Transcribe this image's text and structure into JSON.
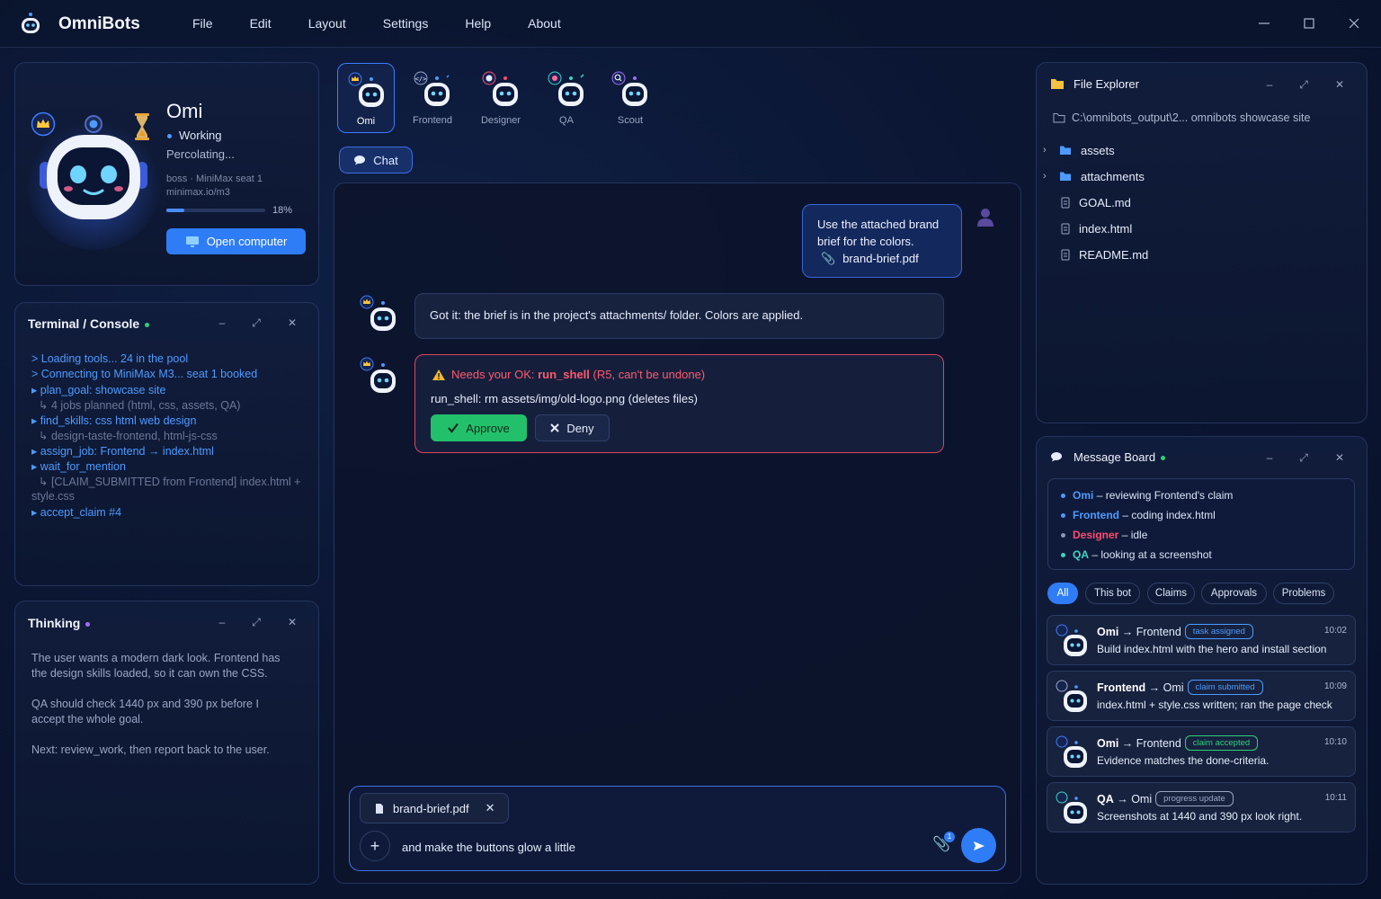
{
  "app": {
    "name": "OmniBots",
    "menu": [
      "File",
      "Edit",
      "Layout",
      "Settings",
      "Help",
      "About"
    ]
  },
  "profile": {
    "name": "Omi",
    "status": "Working",
    "substatus": "Percolating...",
    "meta_line1": "boss · MiniMax seat 1",
    "meta_line2": "minimax.io/m3",
    "progress": 0.18,
    "progress_label": "18%",
    "open_computer_label": "Open computer"
  },
  "terminal": {
    "title": "Terminal / Console",
    "lines": [
      {
        "text": "> Loading tools... 24 in the pool",
        "kind": "main"
      },
      {
        "text": "> Connecting to MiniMax M3... seat 1 booked",
        "kind": "main"
      },
      {
        "text": "▸ plan_goal: showcase site",
        "kind": "main"
      },
      {
        "text": "↳ 4 jobs planned (html, css, assets, QA)",
        "kind": "sub"
      },
      {
        "text": "▸ find_skills: css html web design",
        "kind": "main"
      },
      {
        "text": "↳ design-taste-frontend, html-js-css",
        "kind": "sub"
      },
      {
        "text": "▸ assign_job: Frontend → index.html",
        "kind": "main"
      },
      {
        "text": "▸ wait_for_mention",
        "kind": "main"
      },
      {
        "text": "↳ [CLAIM_SUBMITTED from Frontend] index.html +",
        "kind": "sub"
      },
      {
        "text": "style.css",
        "kind": "sub"
      },
      {
        "text": "▸ accept_claim #4",
        "kind": "main"
      }
    ]
  },
  "thinking": {
    "title": "Thinking",
    "paragraphs": [
      [
        "The user wants a modern dark look. Frontend has",
        "the design skills loaded, so it can own the CSS."
      ],
      [
        "QA should check 1440 px and 390 px before I",
        "accept the whole goal."
      ],
      [
        "Next: review_work, then report back to the user."
      ]
    ]
  },
  "bot_tabs": [
    {
      "label": "Omi",
      "active": true
    },
    {
      "label": "Frontend",
      "active": false
    },
    {
      "label": "Designer",
      "active": false
    },
    {
      "label": "QA",
      "active": false
    },
    {
      "label": "Scout",
      "active": false
    }
  ],
  "chat": {
    "tab_label": "Chat",
    "user_message": {
      "line1": "Use the attached brand",
      "line2": "brief for the colors.",
      "attachment": "brand-brief.pdf"
    },
    "bot_message": "Got it: the brief is in the project's attachments/ folder. Colors are applied.",
    "approval": {
      "prefix": "Needs your OK: ",
      "tool": "run_shell",
      "suffix": " (R5, can't be undone)",
      "command": "run_shell: rm assets/img/old-logo.png (deletes files)",
      "approve_label": "Approve",
      "deny_label": "Deny"
    },
    "composer": {
      "attachment": "brand-brief.pdf",
      "value": "and make the buttons glow a little",
      "attach_count": "1"
    }
  },
  "file_explorer": {
    "title": "File Explorer",
    "path": "C:\\omnibots_output\\2... omnibots showcase site",
    "items": [
      {
        "name": "assets",
        "type": "folder"
      },
      {
        "name": "attachments",
        "type": "folder"
      },
      {
        "name": "GOAL.md",
        "type": "file"
      },
      {
        "name": "index.html",
        "type": "file"
      },
      {
        "name": "README.md",
        "type": "file"
      }
    ]
  },
  "message_board": {
    "title": "Message Board",
    "statuses": [
      {
        "bot": "Omi",
        "text": "– reviewing Frontend's claim",
        "color": "#4d9bff"
      },
      {
        "bot": "Frontend",
        "text": "– coding index.html",
        "color": "#4d9bff"
      },
      {
        "bot": "Designer",
        "text": "– idle",
        "color": "#ff4d6d"
      },
      {
        "bot": "QA",
        "text": "– looking at a screenshot",
        "color": "#3dd6c3"
      }
    ],
    "filters": [
      "All",
      "This bot",
      "Claims",
      "Approvals",
      "Problems"
    ],
    "messages": [
      {
        "from": "Omi",
        "to": "Frontend",
        "tag": "task assigned",
        "tag_color": "#4d9bff",
        "time": "10:02",
        "body": "Build index.html with the hero and install section"
      },
      {
        "from": "Frontend",
        "to": "Omi",
        "tag": "claim submitted",
        "tag_color": "#4d9bff",
        "time": "10:09",
        "body": "index.html + style.css written; ran the page check"
      },
      {
        "from": "Omi",
        "to": "Frontend",
        "tag": "claim accepted",
        "tag_color": "#2fd07a",
        "time": "10:10",
        "body": "Evidence matches the done-criteria."
      },
      {
        "from": "QA",
        "to": "Omi",
        "tag": "progress update",
        "tag_color": "#9aa6c4",
        "time": "10:11",
        "body": "Screenshots at 1440 and 390 px look right."
      }
    ]
  },
  "colors": {
    "accent": "#2f7df6",
    "working": "#4d9bff",
    "danger": "#e0455e",
    "success": "#23c06c",
    "thinking_dot": "#a56bff",
    "online_dot": "#2fd07a"
  }
}
